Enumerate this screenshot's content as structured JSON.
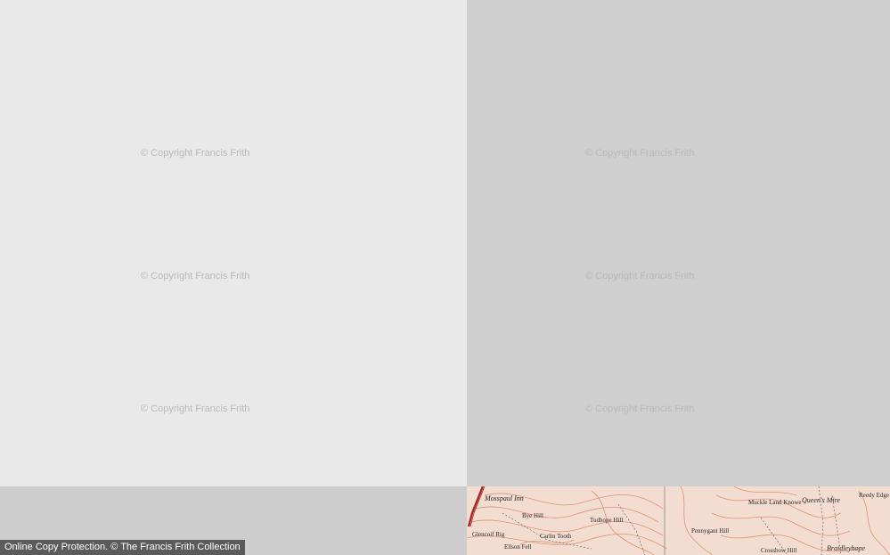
{
  "watermark": {
    "text": "© Copyright Francis Frith",
    "count": 6
  },
  "overlay": {
    "label": "Online Copy Protection.  © The Francis Frith Collection"
  },
  "map": {
    "labels": [
      "Mosspaul Inn",
      "Bye Hill",
      "Tudhope Hill",
      "Glencoif Rig",
      "Ellson Fell",
      "Carlin Tooth",
      "Pennygant Hill",
      "Muckle Land Knowe",
      "Queen's Mire",
      "Crossbow Hill",
      "Reedy Edge",
      "Braidleyhope"
    ],
    "colors": {
      "paper": "#f3ddd0",
      "contour": "#d9866a",
      "road": "#b52222",
      "text": "#2a2a2a"
    }
  }
}
